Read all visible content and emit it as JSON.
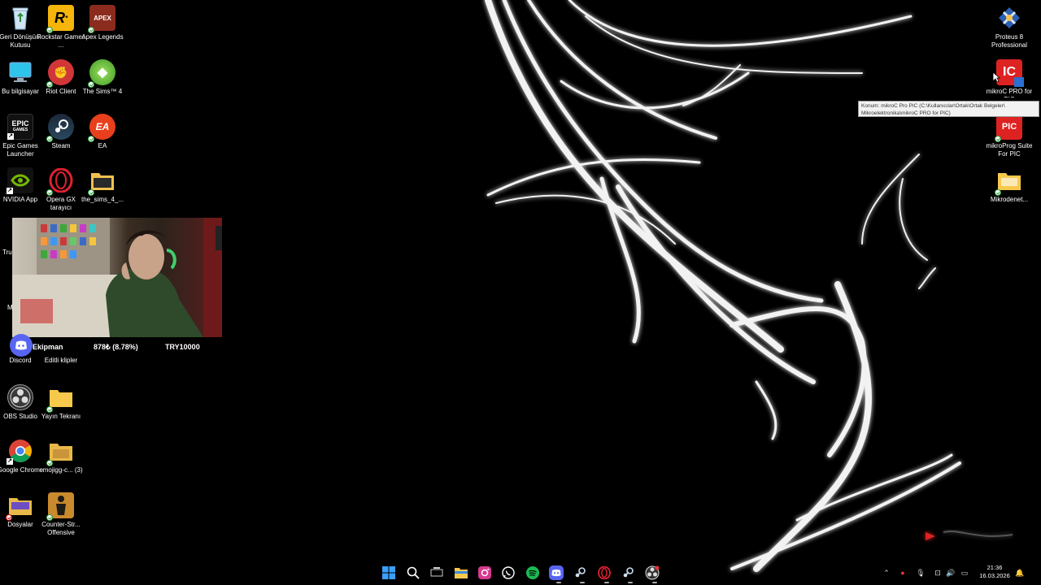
{
  "desktop": {
    "left_icons": [
      {
        "label": "Geri Dönüşüm Kutusu"
      },
      {
        "label": "Rockstar Games ..."
      },
      {
        "label": "Apex Legends"
      },
      {
        "label": "Bu bilgisayar"
      },
      {
        "label": "Riot Client"
      },
      {
        "label": "The Sims™ 4"
      },
      {
        "label": "Epic Games Launcher"
      },
      {
        "label": "Steam"
      },
      {
        "label": "EA"
      },
      {
        "label": "NVIDIA App"
      },
      {
        "label": "Opera GX tarayıcı"
      },
      {
        "label": "the_sims_4_..."
      },
      {
        "label": "Discord"
      },
      {
        "label": "Editli klipler"
      },
      {
        "label": "OBS Studio"
      },
      {
        "label": "Yayın Tekranı"
      },
      {
        "label": "Google Chrome"
      },
      {
        "label": "emojigg-c... (3)"
      },
      {
        "label": "Dosyalar"
      },
      {
        "label": "Counter-Str... Offensive"
      }
    ],
    "right_icons": [
      {
        "label": "Proteus 8 Professional"
      },
      {
        "label": "mikroC PRO for PIC"
      },
      {
        "label": "mikroProg Suite For PIC"
      },
      {
        "label": "Mikrodenet..."
      }
    ],
    "partial_labels": [
      "Tru",
      "M"
    ]
  },
  "overlay": {
    "name": "Ekipman",
    "stat": "878₺ (8.78%)",
    "goal": "TRY10000"
  },
  "tooltip": {
    "text": "Konum: mikroC Pro PIC (C:\\Kullanıcılar\\Ortak\\Ortak Belgeler\\ Mikroelektronika\\mikroC PRO for PIC)"
  },
  "taskbar": {
    "apps": [
      "start-icon",
      "search-icon",
      "task-view-icon",
      "file-explorer-icon",
      "instagram-icon",
      "whatsapp-icon",
      "spotify-icon",
      "discord-icon",
      "steam-icon",
      "opera-gx-icon",
      "steam-icon",
      "obs-icon"
    ],
    "time": "21:36",
    "date": "16.03.2026"
  },
  "colors": {
    "background": "#000000",
    "accent_green": "#2e9e3f"
  }
}
